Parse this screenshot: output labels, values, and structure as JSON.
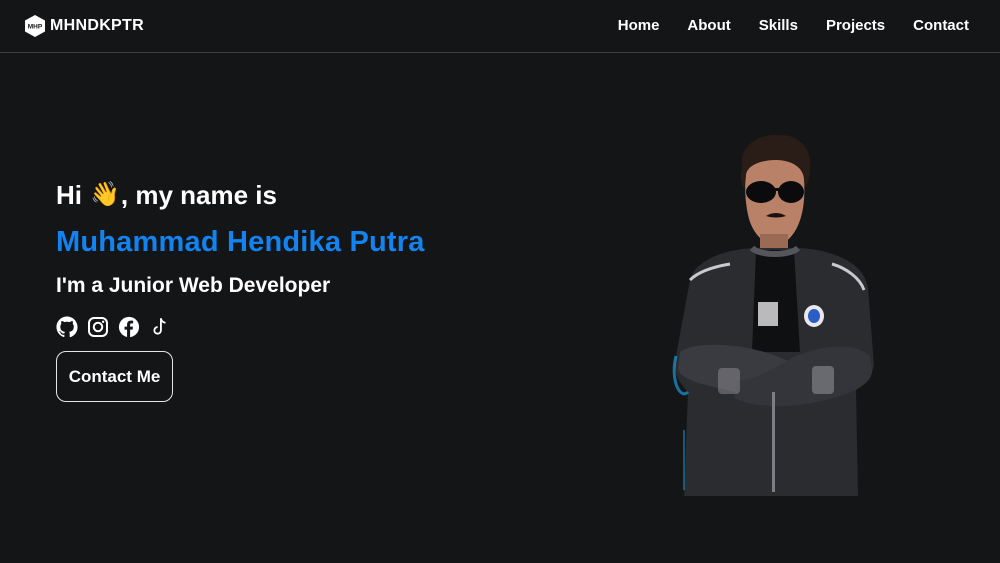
{
  "nav": {
    "brand_logo_text": "MHP",
    "brand_name": "MHNDKPTR",
    "links": [
      "Home",
      "About",
      "Skills",
      "Projects",
      "Contact"
    ]
  },
  "hero": {
    "greeting_hi": "Hi",
    "wave_emoji": "👋",
    "greeting_rest": ", my name is",
    "name": "Muhammad Hendika Putra",
    "role": "I'm a Junior Web Developer",
    "social_icons": [
      "github-icon",
      "instagram-icon",
      "facebook-icon",
      "tiktok-icon"
    ],
    "cta_label": "Contact Me"
  },
  "colors": {
    "background": "#141517",
    "accent": "#1283f0",
    "text": "#ffffff"
  }
}
